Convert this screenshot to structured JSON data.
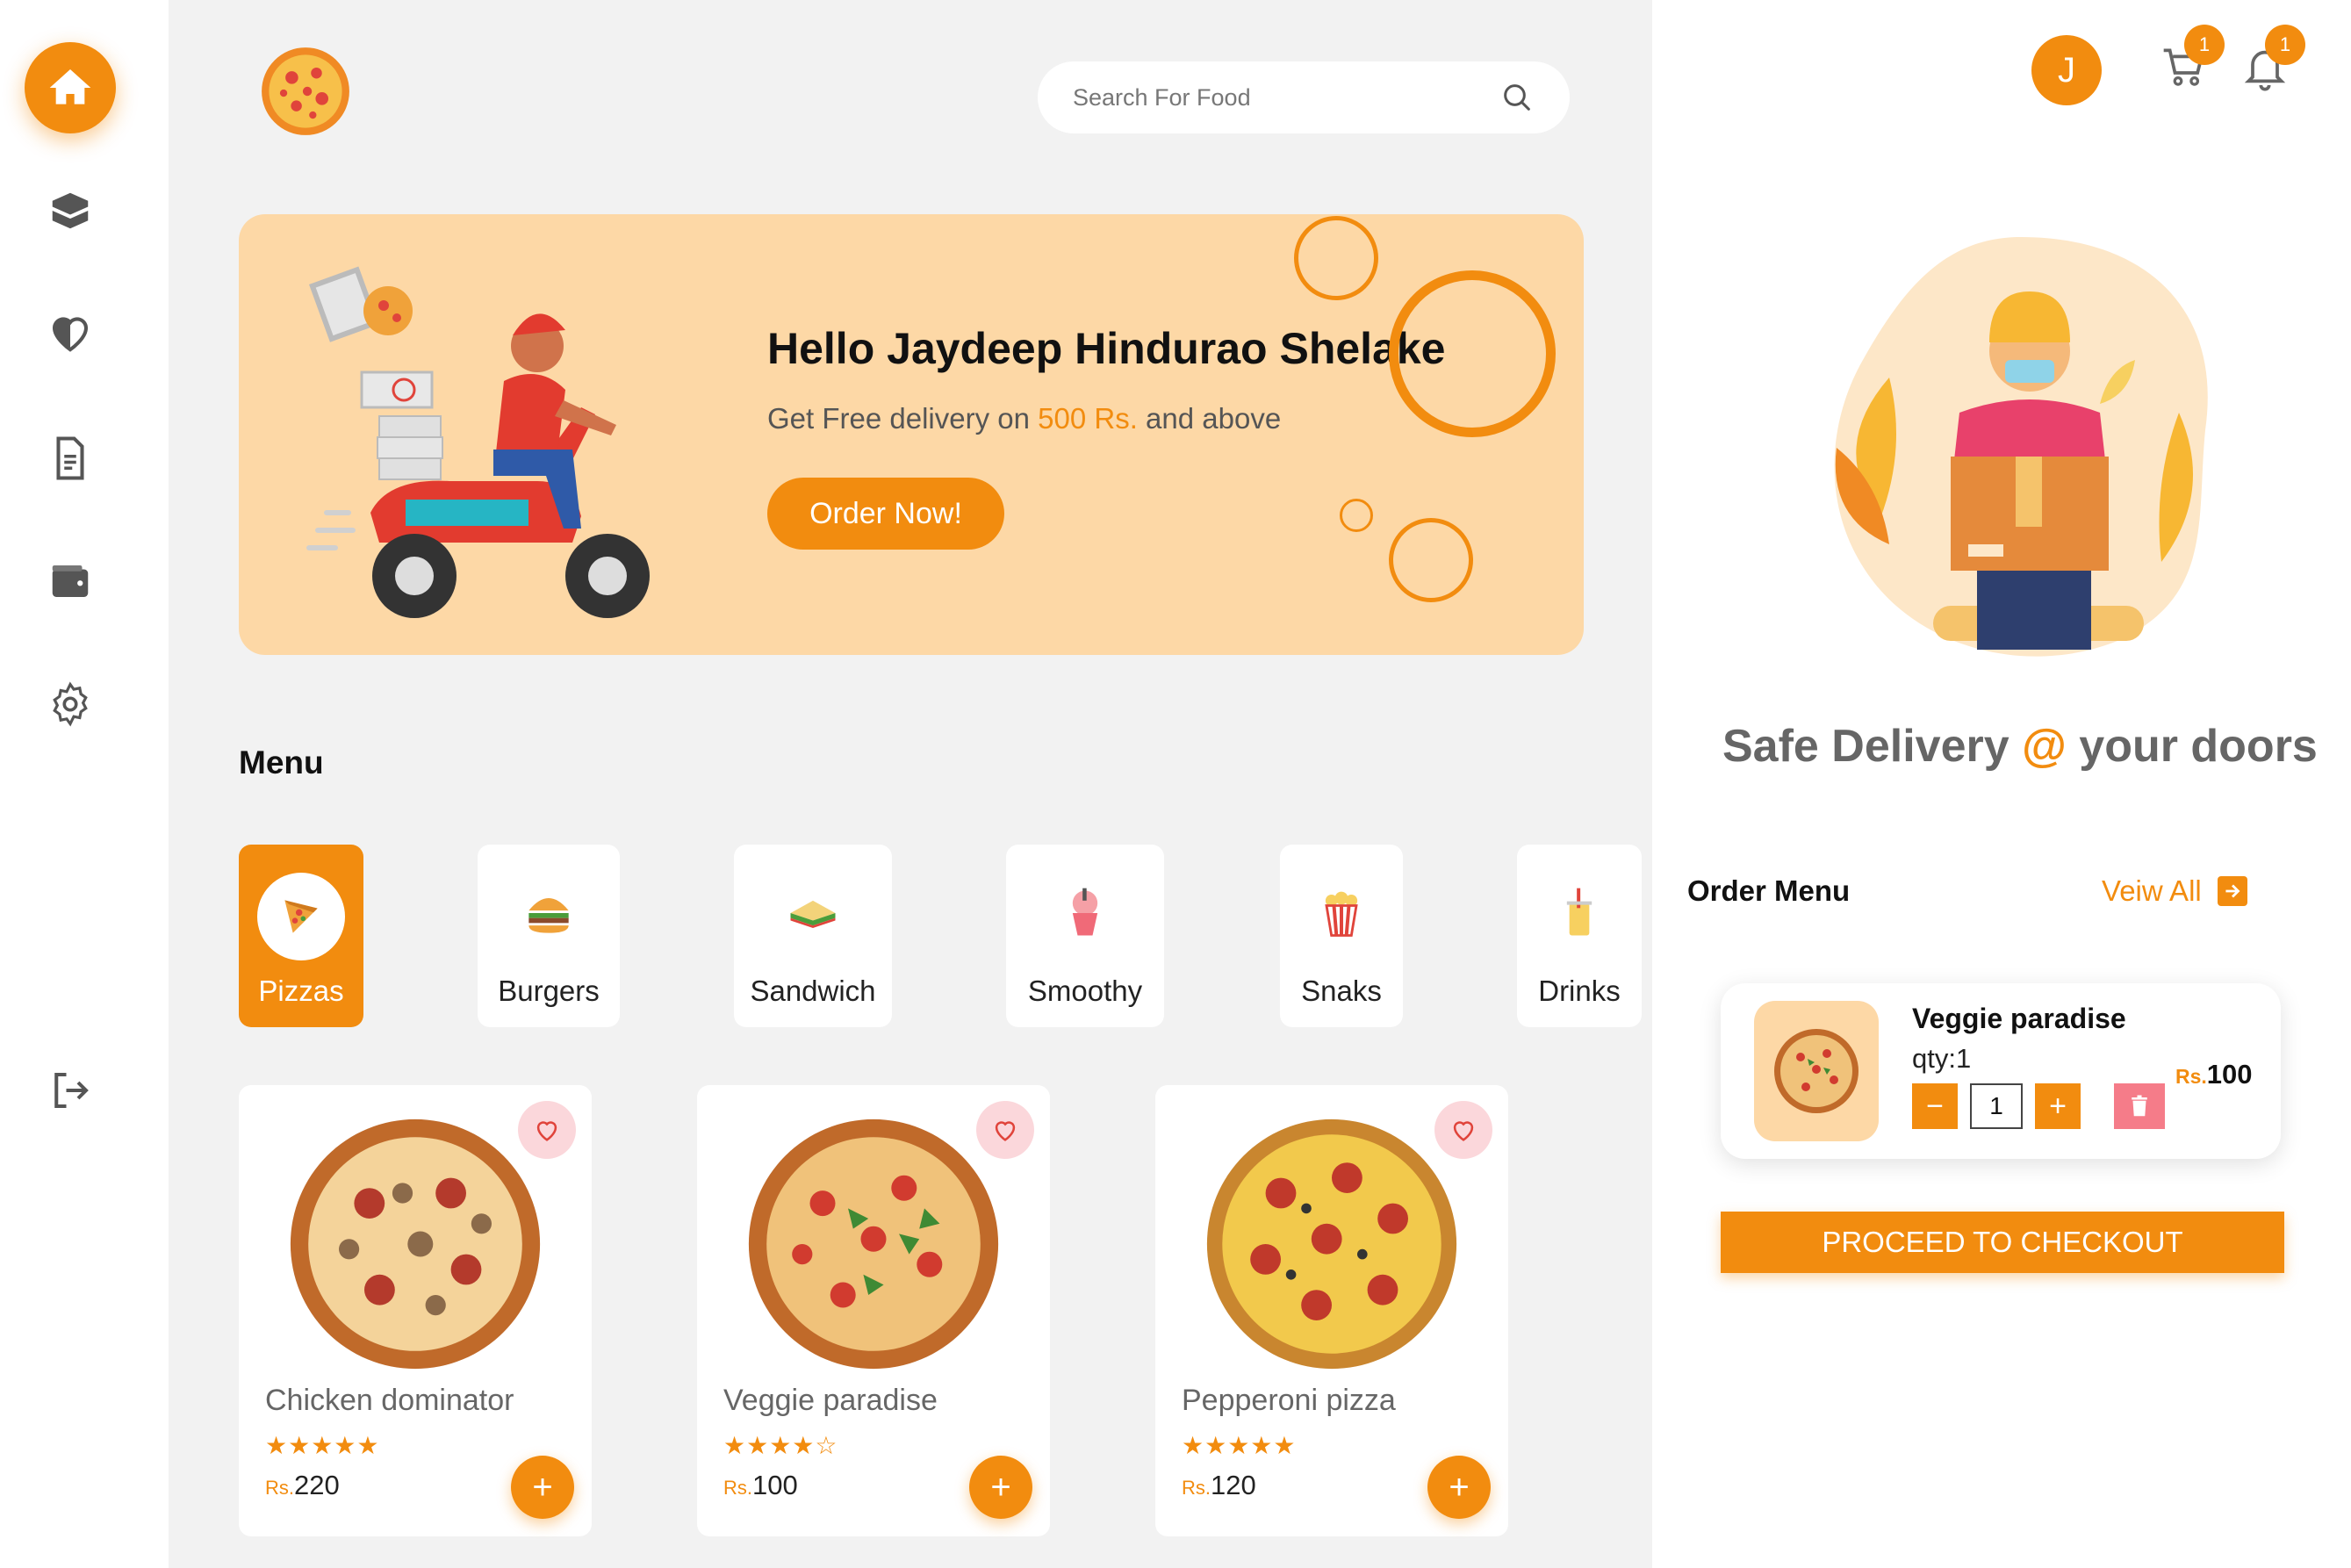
{
  "search": {
    "placeholder": "Search For Food"
  },
  "banner": {
    "greeting": "Hello Jaydeep Hindurao Shelake",
    "subtitle_prefix": "Get Free delivery on ",
    "subtitle_highlight": "500 Rs.",
    "subtitle_suffix": " and above",
    "cta": "Order Now!"
  },
  "menu": {
    "title": "Menu",
    "categories": [
      {
        "label": "Pizzas",
        "active": true
      },
      {
        "label": "Burgers"
      },
      {
        "label": "Sandwich"
      },
      {
        "label": "Smoothy"
      },
      {
        "label": "Snaks"
      },
      {
        "label": "Drinks"
      }
    ]
  },
  "products": [
    {
      "name": "Chicken dominator",
      "rating": 5,
      "stars": "★★★★★",
      "currency": "Rs.",
      "price": "220"
    },
    {
      "name": "Veggie paradise",
      "rating": 4,
      "stars": "★★★★☆",
      "currency": "Rs.",
      "price": "100"
    },
    {
      "name": "Pepperoni pizza",
      "rating": 5,
      "stars": "★★★★★",
      "currency": "Rs.",
      "price": "120"
    }
  ],
  "header": {
    "avatar_initial": "J",
    "cart_count": "1",
    "notification_count": "1"
  },
  "right_panel": {
    "safe_prefix": "Safe Delivery ",
    "safe_at": "@",
    "safe_suffix": " your doors",
    "order_menu_title": "Order Menu",
    "view_all": "Veiw All",
    "order_item": {
      "name": "Veggie paradise",
      "qty_label": "qty:1",
      "quantity": "1",
      "currency": "Rs.",
      "price": "100"
    },
    "checkout": "PROCEED TO CHECKOUT"
  },
  "colors": {
    "accent": "#f28c0f",
    "banner_bg": "#fdd8a6",
    "main_bg": "#f2f2f2"
  }
}
